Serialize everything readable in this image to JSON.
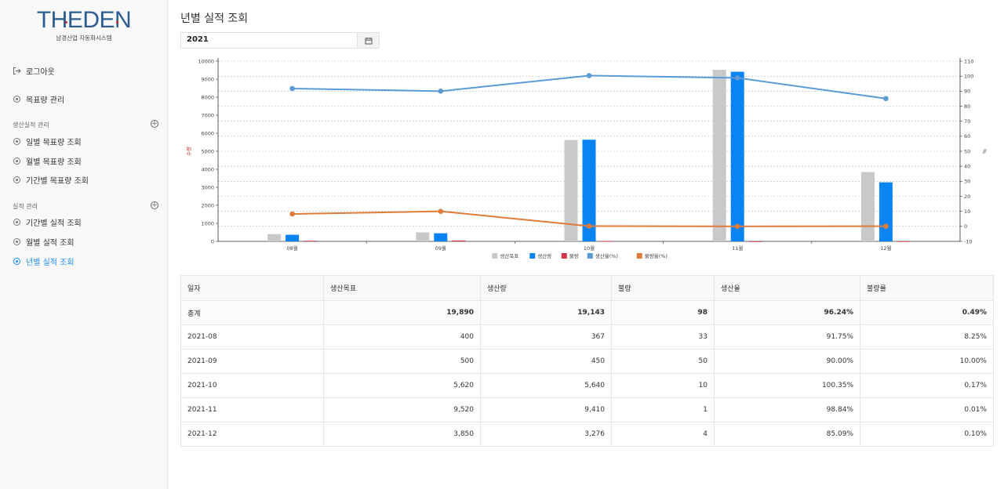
{
  "app": {
    "logo_text": "THEDEN",
    "logo_sub": "남경산업 자동화시스템"
  },
  "sidebar": {
    "logout": "로그아웃",
    "target_mgmt": "목표량 관리",
    "sections": [
      {
        "title": "생산실적 관리",
        "items": [
          "일별 목표량 조회",
          "월별 목표량 조회",
          "기간별 목표량 조회"
        ]
      },
      {
        "title": "실적 관리",
        "items": [
          "기간별 실적 조회",
          "월별 실적 조회",
          "년별 실적 조회"
        ]
      }
    ],
    "active_item": "년별 실적 조회"
  },
  "page": {
    "title": "년별 실적 조회",
    "year_value": "2021"
  },
  "chart_data": {
    "type": "bar",
    "categories": [
      "08월",
      "09월",
      "10월",
      "11월",
      "12월"
    ],
    "series": [
      {
        "name": "생산목표",
        "kind": "bar",
        "axis": "left",
        "color": "#c9c9c9",
        "values": [
          400,
          500,
          5620,
          9520,
          3850
        ]
      },
      {
        "name": "생산량",
        "kind": "bar",
        "axis": "left",
        "color": "#0a84f5",
        "values": [
          367,
          450,
          5640,
          9410,
          3276
        ]
      },
      {
        "name": "불량",
        "kind": "bar",
        "axis": "left",
        "color": "#d6334a",
        "values": [
          33,
          50,
          10,
          1,
          4
        ]
      },
      {
        "name": "생산율(%)",
        "kind": "line",
        "axis": "right",
        "color": "#5b9bd5",
        "values": [
          91.75,
          90.0,
          100.35,
          98.84,
          85.09
        ]
      },
      {
        "name": "불량율(%)",
        "kind": "line",
        "axis": "right",
        "color": "#e07b39",
        "values": [
          8.25,
          10.0,
          0.17,
          0.01,
          0.1
        ]
      }
    ],
    "ylabel_left": "수량",
    "ylabel_right": "%",
    "ylim_left": [
      0,
      10000
    ],
    "ylim_right": [
      -10,
      110
    ],
    "yticks_left": [
      0,
      1000,
      2000,
      3000,
      4000,
      5000,
      6000,
      7000,
      8000,
      9000,
      10000
    ],
    "yticks_right": [
      -10,
      0,
      10,
      20,
      30,
      40,
      50,
      60,
      70,
      80,
      90,
      100,
      110
    ],
    "grid": true,
    "legend": "bottom"
  },
  "table": {
    "headers": [
      "일자",
      "생산목표",
      "생산량",
      "불량",
      "생산율",
      "불량률"
    ],
    "total": [
      "총계",
      "19,890",
      "19,143",
      "98",
      "96.24%",
      "0.49%"
    ],
    "rows": [
      [
        "2021-08",
        "400",
        "367",
        "33",
        "91.75%",
        "8.25%"
      ],
      [
        "2021-09",
        "500",
        "450",
        "50",
        "90.00%",
        "10.00%"
      ],
      [
        "2021-10",
        "5,620",
        "5,640",
        "10",
        "100.35%",
        "0.17%"
      ],
      [
        "2021-11",
        "9,520",
        "9,410",
        "1",
        "98.84%",
        "0.01%"
      ],
      [
        "2021-12",
        "3,850",
        "3,276",
        "4",
        "85.09%",
        "0.10%"
      ]
    ]
  }
}
